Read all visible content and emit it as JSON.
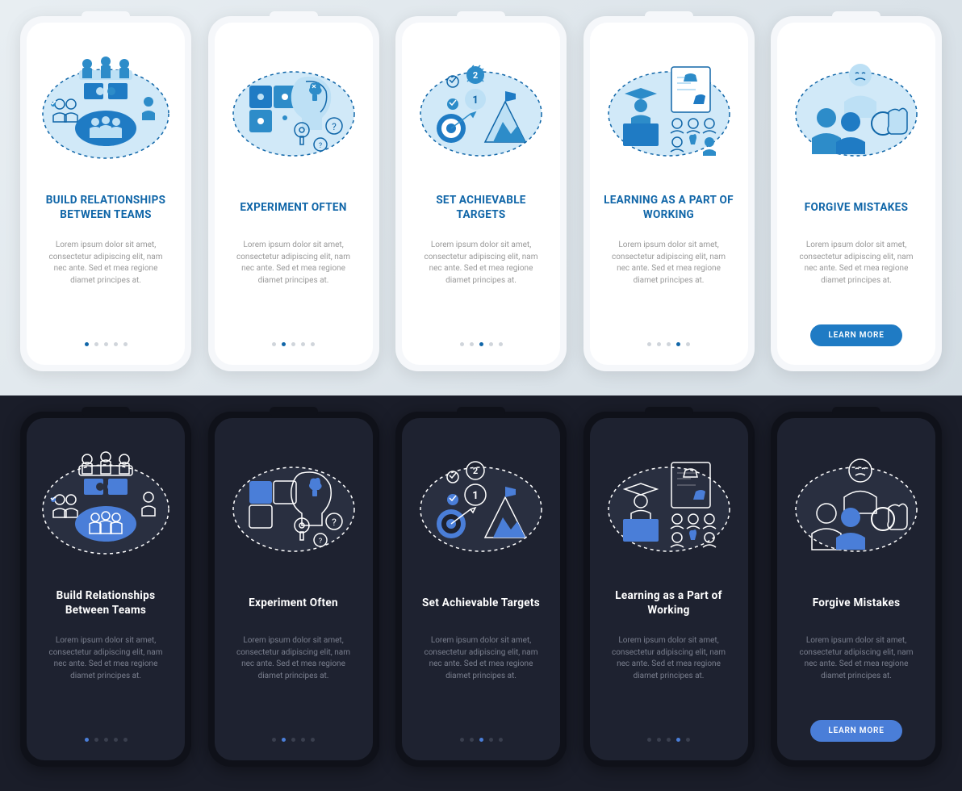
{
  "colors": {
    "primary_light": "#1066a8",
    "primary_dark": "#4a7ed8",
    "accent": "#2d8cc9"
  },
  "lorem": "Lorem ipsum dolor sit amet, consectetur adipiscing elit, nam nec ante. Sed et mea regione diamet principes at.",
  "cta": "LEARN MORE",
  "light": {
    "cards": [
      {
        "title": "BUILD RELATIONSHIPS BETWEEN TEAMS",
        "active": 0,
        "dots": 5
      },
      {
        "title": "EXPERIMENT OFTEN",
        "active": 1,
        "dots": 5
      },
      {
        "title": "SET ACHIEVABLE TARGETS",
        "active": 2,
        "dots": 5
      },
      {
        "title": "LEARNING AS A PART OF WORKING",
        "active": 3,
        "dots": 5
      },
      {
        "title": "FORGIVE MISTAKES",
        "active": 4,
        "dots": 0,
        "cta": true
      }
    ]
  },
  "dark": {
    "cards": [
      {
        "title": "Build Relationships Between Teams",
        "active": 0,
        "dots": 5
      },
      {
        "title": "Experiment Often",
        "active": 1,
        "dots": 5
      },
      {
        "title": "Set Achievable Targets",
        "active": 2,
        "dots": 5
      },
      {
        "title": "Learning as a Part of Working",
        "active": 3,
        "dots": 5
      },
      {
        "title": "Forgive Mistakes",
        "active": 4,
        "dots": 0,
        "cta": true
      }
    ]
  },
  "icon_names": [
    "relationships-icon",
    "experiment-icon",
    "targets-icon",
    "learning-icon",
    "forgive-icon"
  ]
}
